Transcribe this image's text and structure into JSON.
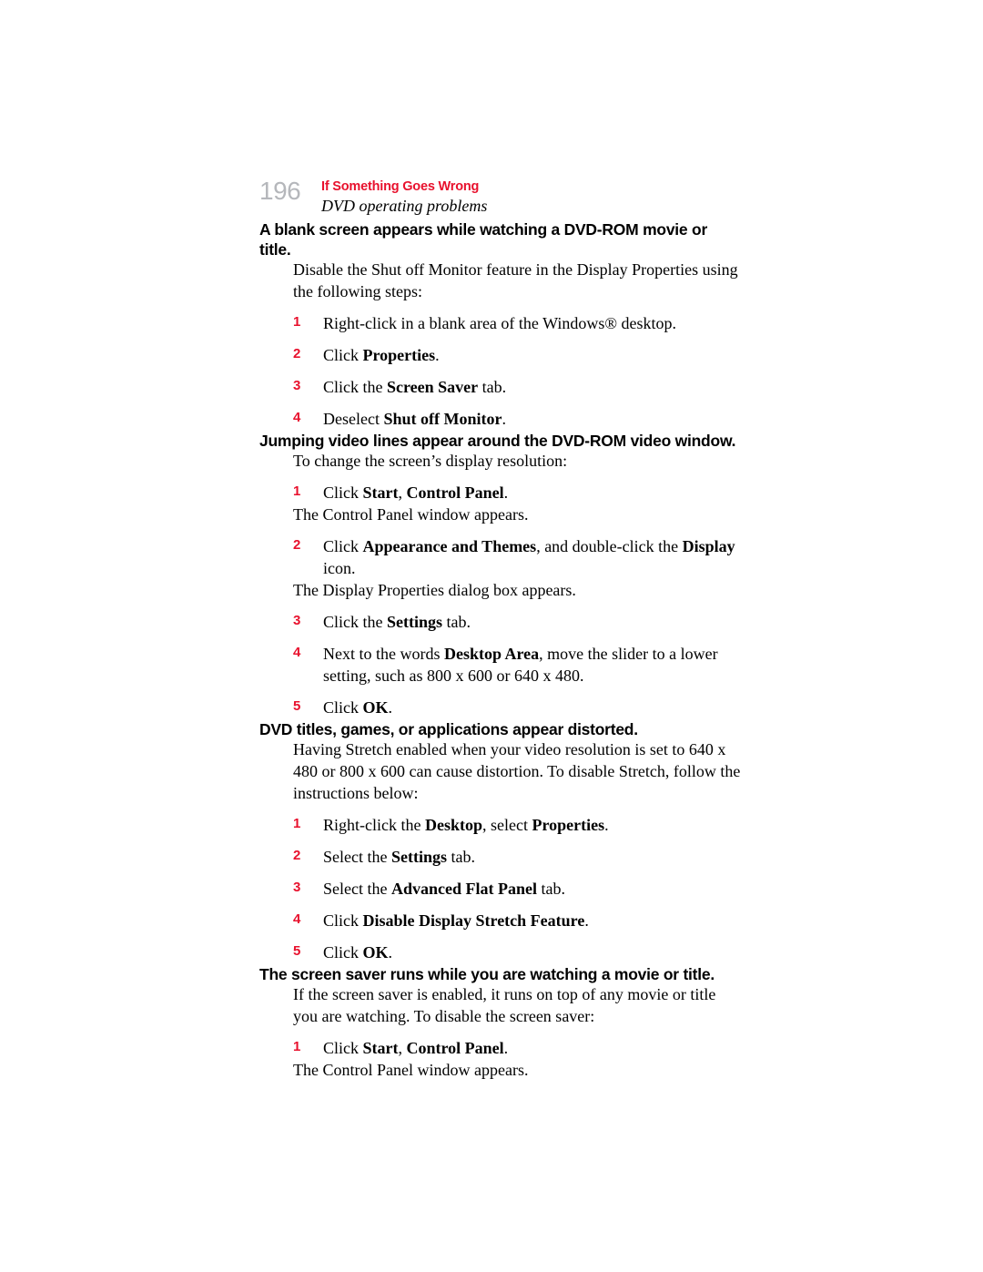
{
  "header": {
    "page_number": "196",
    "chapter": "If Something Goes Wrong",
    "section": "DVD operating problems"
  },
  "sections": [
    {
      "heading": "A blank screen appears while watching a DVD-ROM movie or title.",
      "intro": "Disable the Shut off Monitor feature in the Display Properties using the following steps:",
      "steps": [
        {
          "num": "1",
          "text_html": "Right-click in a blank area of the Windows® desktop."
        },
        {
          "num": "2",
          "text_html": "Click <b>Properties</b>."
        },
        {
          "num": "3",
          "text_html": "Click the <b>Screen Saver</b> tab."
        },
        {
          "num": "4",
          "text_html": "Deselect <b>Shut off Monitor</b>."
        }
      ]
    },
    {
      "heading": "Jumping video lines appear around the DVD-ROM video window.",
      "intro": "To change the screen’s display resolution:",
      "steps": [
        {
          "num": "1",
          "text_html": "Click <b>Start</b>, <b>Control Panel</b>."
        },
        {
          "num": "",
          "text_html": "The Control Panel window appears.",
          "note": true
        },
        {
          "num": "2",
          "text_html": "Click <b>Appearance and Themes</b>, and double-click the <b>Display</b> icon."
        },
        {
          "num": "",
          "text_html": "The Display Properties dialog box appears.",
          "note": true
        },
        {
          "num": "3",
          "text_html": "Click the <b>Settings</b> tab."
        },
        {
          "num": "4",
          "text_html": "Next to the words <b>Desktop Area</b>, move the slider to a lower setting, such as 800 x 600 or 640 x 480."
        },
        {
          "num": "5",
          "text_html": "Click <b>OK</b>."
        }
      ]
    },
    {
      "heading": "DVD titles, games, or applications appear distorted.",
      "intro": "Having Stretch enabled when your video resolution is set to 640 x 480 or 800 x 600 can cause distortion. To disable Stretch, follow the instructions below:",
      "steps": [
        {
          "num": "1",
          "text_html": "Right-click the <b>Desktop</b>, select <b>Properties</b>."
        },
        {
          "num": "2",
          "text_html": "Select the <b>Settings</b> tab."
        },
        {
          "num": "3",
          "text_html": "Select the <b>Advanced Flat Panel</b> tab."
        },
        {
          "num": "4",
          "text_html": "Click <b>Disable Display Stretch Feature</b>."
        },
        {
          "num": "5",
          "text_html": "Click <b>OK</b>."
        }
      ]
    },
    {
      "heading": "The screen saver runs while you are watching a movie or title.",
      "intro": "If the screen saver is enabled, it runs on top of any movie or title you are watching. To disable the screen saver:",
      "steps": [
        {
          "num": "1",
          "text_html": "Click <b>Start</b>, <b>Control Panel</b>."
        },
        {
          "num": "",
          "text_html": "The Control Panel window appears.",
          "note": true
        }
      ]
    }
  ],
  "colors": {
    "accent_red": "#e8112d",
    "page_number_gray": "#b5b7bb"
  }
}
